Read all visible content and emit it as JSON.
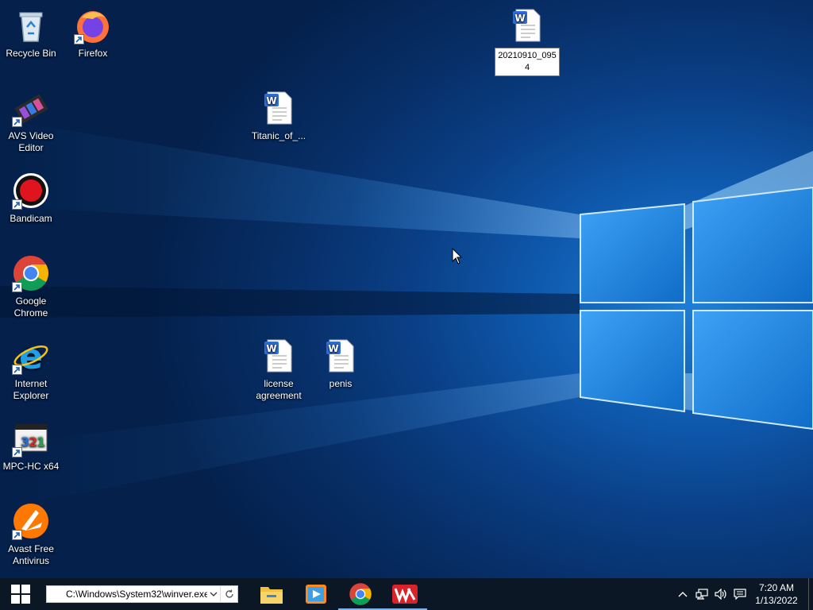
{
  "desktop": {
    "icons": [
      {
        "name": "recycle-bin",
        "label": "Recycle Bin"
      },
      {
        "name": "firefox",
        "label": "Firefox"
      },
      {
        "name": "avs-video-editor",
        "label": "AVS Video Editor"
      },
      {
        "name": "bandicam",
        "label": "Bandicam"
      },
      {
        "name": "google-chrome",
        "label": "Google Chrome"
      },
      {
        "name": "internet-explorer",
        "label": "Internet Explorer"
      },
      {
        "name": "mpc-hc-x64",
        "label": "MPC-HC x64"
      },
      {
        "name": "avast-free-antivirus",
        "label": "Avast Free Antivirus"
      },
      {
        "name": "titanic-doc",
        "label": "Titanic_of_..."
      },
      {
        "name": "license-agreement-doc",
        "label": "license agreement"
      },
      {
        "name": "penis-doc",
        "label": "penis"
      },
      {
        "name": "doc-20210910",
        "label": "20210910_0954",
        "selected": true
      }
    ]
  },
  "taskbar": {
    "address_value": "C:\\Windows\\System32\\winver.exe",
    "apps": [
      {
        "name": "file-explorer",
        "running": false
      },
      {
        "name": "media-player",
        "running": false
      },
      {
        "name": "google-chrome",
        "running": true
      },
      {
        "name": "wps-office",
        "running": true
      }
    ],
    "clock": {
      "time": "7:20 AM",
      "date": "1/13/2022"
    }
  },
  "colors": {
    "taskbar": "#0b1724",
    "wallpaper_dark": "#04204b",
    "wallpaper_light": "#1e7fd6",
    "running_indicator": "#7eb4ea"
  }
}
